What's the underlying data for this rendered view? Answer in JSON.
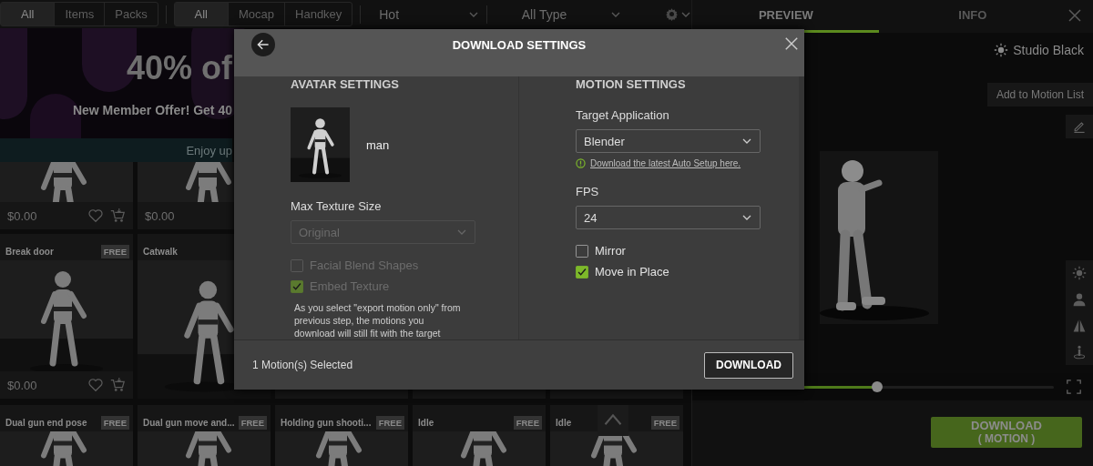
{
  "filter_bar": {
    "scope_tabs": [
      {
        "label": "All",
        "selected": true
      },
      {
        "label": "Items",
        "selected": false
      },
      {
        "label": "Packs",
        "selected": false
      }
    ],
    "source_tabs": [
      {
        "label": "All",
        "selected": true
      },
      {
        "label": "Mocap",
        "selected": false
      },
      {
        "label": "Handkey",
        "selected": false
      }
    ],
    "sort_dropdown": {
      "value": "Hot"
    },
    "type_dropdown": {
      "value": "All Type"
    }
  },
  "banner": {
    "headline": "40% of",
    "offer": "New Member Offer! Get 40",
    "strip": "Enjoy up"
  },
  "card_rows": [
    {
      "cards": [
        {
          "kind": "full",
          "price": "$0.00"
        },
        {
          "kind": "price",
          "price": "$0.00"
        }
      ]
    },
    {
      "cards": [
        {
          "kind": "full",
          "title": "Break door",
          "badge": "FREE",
          "price": "$0.00"
        },
        {
          "title": "Catwalk"
        }
      ]
    },
    {
      "cards": [
        {
          "title": "Dual gun end pose",
          "badge": "FREE"
        },
        {
          "title": "Dual gun move and...",
          "badge": "FREE"
        },
        {
          "title": "Holding gun shooti...",
          "badge": "FREE"
        },
        {
          "title": "Idle",
          "badge": "FREE"
        },
        {
          "title": "Idle",
          "badge": "FREE"
        }
      ]
    }
  ],
  "preview_panel": {
    "tabs": [
      {
        "label": "PREVIEW",
        "selected": true
      },
      {
        "label": "INFO",
        "selected": false
      }
    ],
    "environment": "Studio Black",
    "add_button": "Add to Motion List",
    "playback": {
      "level": 0.47
    },
    "download_button": {
      "label": "DOWNLOAD",
      "sublabel": "( MOTION )"
    }
  },
  "dialog": {
    "title": "DOWNLOAD SETTINGS",
    "avatar_settings": {
      "heading": "AVATAR SETTINGS",
      "avatar_name": "man",
      "max_texture_label": "Max Texture Size",
      "max_texture_value": "Original",
      "max_texture_disabled": true,
      "options": [
        {
          "label": "Facial Blend Shapes",
          "checked": false,
          "disabled": true
        },
        {
          "label": "Embed Texture",
          "checked": true,
          "disabled": true
        }
      ],
      "note": "As you select \"export motion only\" from previous step, the motions you download will still fit with the target"
    },
    "motion_settings": {
      "heading": "MOTION SETTINGS",
      "target_label": "Target Application",
      "target_value": "Blender",
      "setup_link": "Download the latest Auto Setup here.",
      "fps_label": "FPS",
      "fps_value": "24",
      "options": [
        {
          "label": "Mirror",
          "checked": false,
          "disabled": false
        },
        {
          "label": "Move in Place",
          "checked": true,
          "disabled": false
        }
      ]
    },
    "footer": {
      "selected_count": "1 Motion(s) Selected",
      "download_button": "DOWNLOAD"
    }
  }
}
